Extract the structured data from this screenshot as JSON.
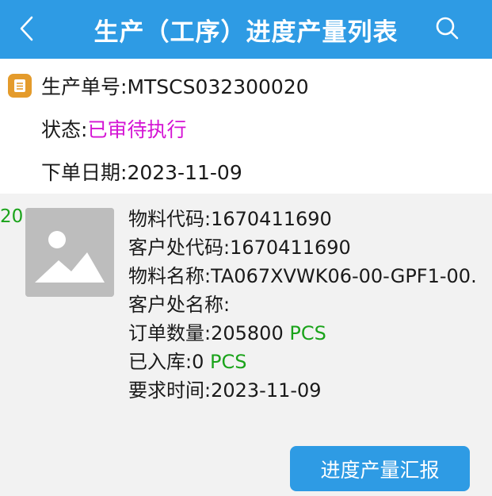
{
  "header": {
    "title": "生产（工序）进度产量列表",
    "back_icon": "chevron-left-icon",
    "search_icon": "search-icon"
  },
  "order": {
    "number_label": "生产单号:",
    "number_value": "MTSCS032300020",
    "status_label": "状态:",
    "status_value": "已审待执行",
    "date_label": "下单日期:",
    "date_value": "2023-11-09",
    "icon": "document-icon"
  },
  "item": {
    "index": "20",
    "image_icon": "image-placeholder-icon",
    "material_code_label": "物料代码:",
    "material_code_value": "1670411690",
    "customer_code_label": "客户处代码:",
    "customer_code_value": "1670411690",
    "material_name_label": "物料名称:",
    "material_name_value": "TA067XVWK06-00-GPF1-00.",
    "customer_name_label": "客户处名称:",
    "customer_name_value": "",
    "order_qty_label": "订单数量:",
    "order_qty_value": "205800",
    "order_qty_unit": "PCS",
    "stocked_label": "已入库:",
    "stocked_value": "0",
    "stocked_unit": "PCS",
    "required_time_label": "要求时间:",
    "required_time_value": "2023-11-09",
    "report_button": "进度产量汇报"
  },
  "colors": {
    "header_bg": "#2e9be4",
    "status": "#d414d4",
    "unit": "#1aa31a",
    "icon_orange": "#e49b2b"
  }
}
